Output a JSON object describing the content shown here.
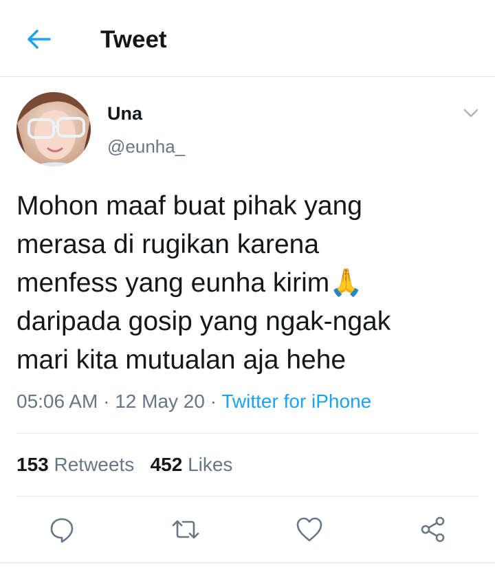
{
  "header": {
    "title": "Tweet",
    "back_icon": "back-arrow-icon"
  },
  "colors": {
    "accent": "#1da1f2",
    "text_primary": "#14171a",
    "text_secondary": "#657786",
    "divider": "#e1e8ed"
  },
  "tweet": {
    "author": {
      "display_name": "Una",
      "handle": "@eunha_"
    },
    "text": "Mohon maaf buat pihak yang\nmerasa di rugikan karena\nmenfess yang eunha kirim🙏\ndaripada gosip yang ngak-ngak\nmari kita mutualan aja hehe",
    "time": "05:06 AM",
    "separator1": " · ",
    "date": "12 May 20",
    "separator2": " · ",
    "source": "Twitter for iPhone",
    "retweets_count": "153",
    "retweets_label": "Retweets",
    "likes_count": "452",
    "likes_label": "Likes"
  },
  "actions": [
    {
      "icon": "reply-icon"
    },
    {
      "icon": "retweet-icon"
    },
    {
      "icon": "like-heart-icon"
    },
    {
      "icon": "share-icon"
    }
  ]
}
